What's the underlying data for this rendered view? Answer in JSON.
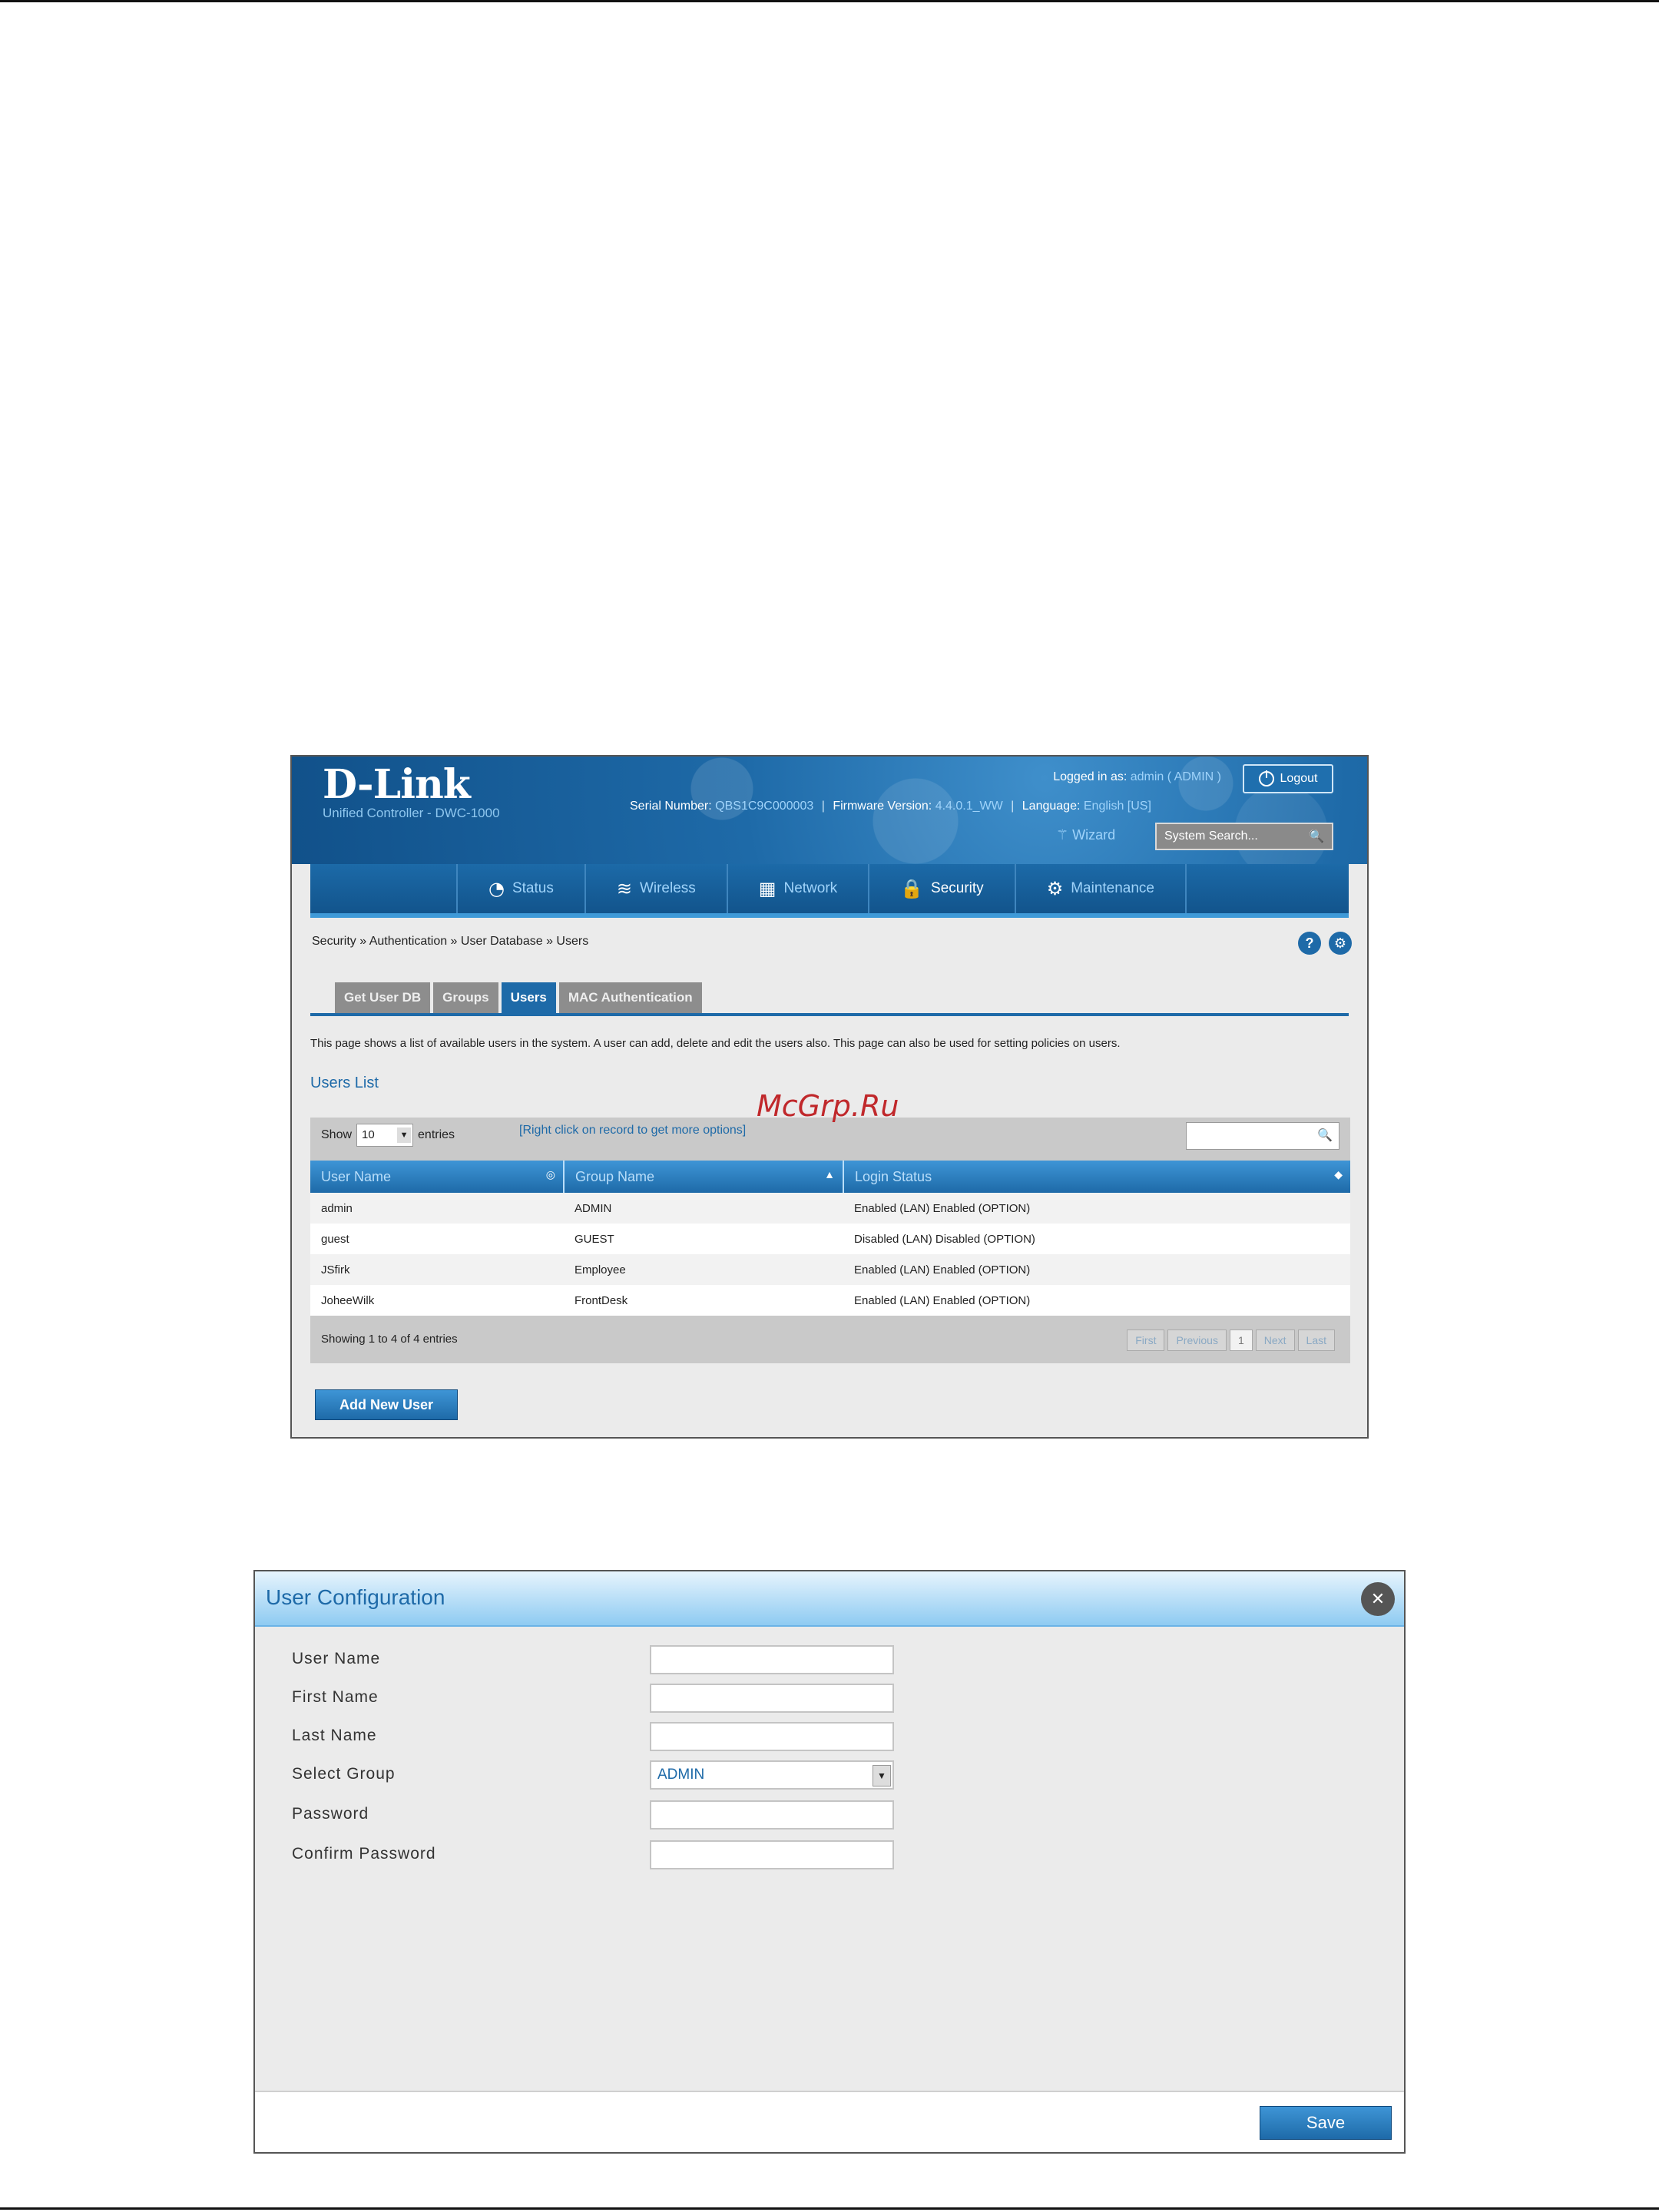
{
  "watermark": "McGrp.Ru",
  "controller": {
    "brand": "D-Link",
    "subtitle": "Unified Controller - DWC-1000",
    "logged_in_label": "Logged in as:",
    "logged_in_user": "admin ( ADMIN )",
    "logout_label": "Logout",
    "serial_label": "Serial Number:",
    "serial_value": "QBS1C9C000003",
    "firmware_label": "Firmware Version:",
    "firmware_value": "4.4.0.1_WW",
    "language_label": "Language:",
    "language_value": "English [US]",
    "wizard_label": "Wizard",
    "search_placeholder": "System Search...",
    "nav": [
      {
        "label": "Status",
        "icon": "gauge-icon"
      },
      {
        "label": "Wireless",
        "icon": "wifi-icon"
      },
      {
        "label": "Network",
        "icon": "network-icon"
      },
      {
        "label": "Security",
        "icon": "lock-icon"
      },
      {
        "label": "Maintenance",
        "icon": "gears-icon"
      }
    ],
    "breadcrumb": "Security  »  Authentication  »  User Database  »  Users",
    "tabs": [
      "Get User DB",
      "Groups",
      "Users",
      "MAC Authentication"
    ],
    "description": "This page shows a list of available users in the system. A user can add, delete and edit the users also. This page can also be used for setting policies on users.",
    "list_title": "Users List",
    "show_label": "Show",
    "show_value": "10",
    "entries_label": "entries",
    "right_click_hint": "[Right click on record to get more options]",
    "columns": [
      "User Name",
      "Group Name",
      "Login Status"
    ],
    "rows": [
      {
        "user": "admin",
        "group": "ADMIN",
        "status": "Enabled (LAN) Enabled (OPTION)"
      },
      {
        "user": "guest",
        "group": "GUEST",
        "status": "Disabled (LAN) Disabled (OPTION)"
      },
      {
        "user": "JSfirk",
        "group": "Employee",
        "status": "Enabled (LAN) Enabled (OPTION)"
      },
      {
        "user": "JoheeWilk",
        "group": "FrontDesk",
        "status": "Enabled (LAN) Enabled (OPTION)"
      }
    ],
    "showing_text": "Showing 1 to 4 of 4 entries",
    "pager": {
      "first": "First",
      "previous": "Previous",
      "page": "1",
      "next": "Next",
      "last": "Last"
    },
    "add_button": "Add New User"
  },
  "user_config": {
    "title": "User Configuration",
    "fields": [
      {
        "label": "User Name",
        "value": ""
      },
      {
        "label": "First Name",
        "value": ""
      },
      {
        "label": "Last Name",
        "value": ""
      },
      {
        "label": "Select Group",
        "value": "ADMIN"
      },
      {
        "label": "Password",
        "value": ""
      },
      {
        "label": "Confirm Password",
        "value": ""
      }
    ],
    "save_button": "Save"
  }
}
